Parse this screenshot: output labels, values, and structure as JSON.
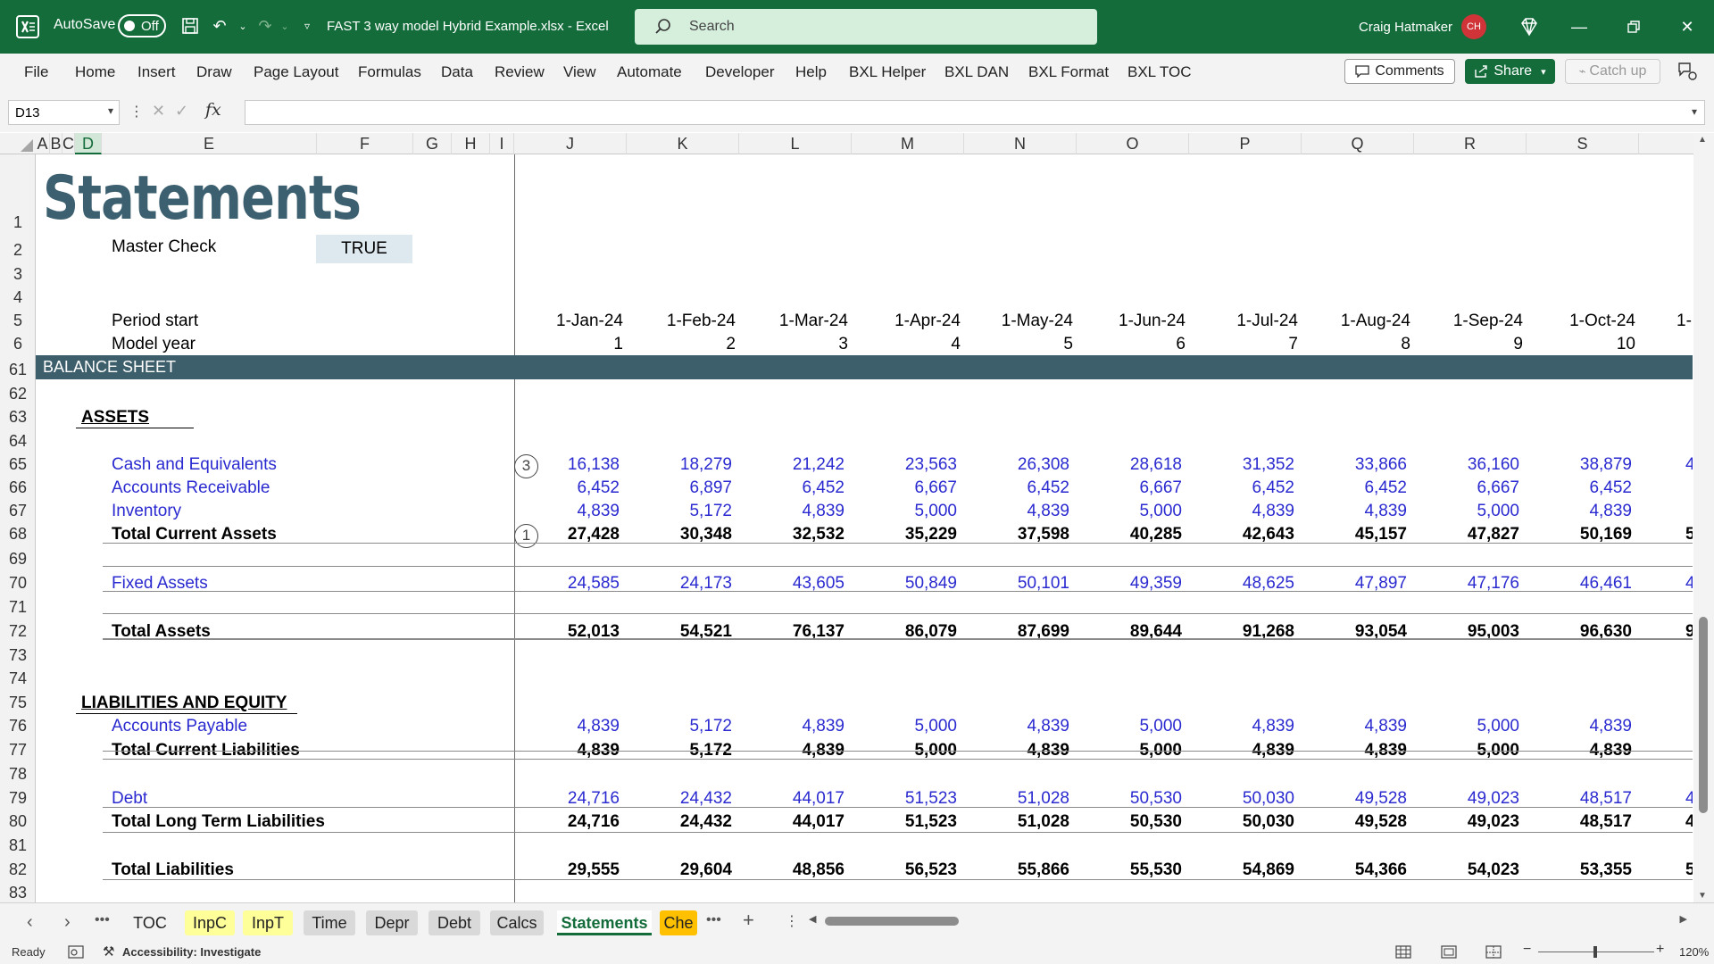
{
  "titlebar": {
    "autosave_label": "AutoSave",
    "autosave_state": "Off",
    "doc_title": "FAST 3 way model Hybrid Example.xlsx  -  Excel",
    "search_placeholder": "Search",
    "user_name": "Craig Hatmaker",
    "user_initials": "CH",
    "accent_color": "#136c3a"
  },
  "ribbon": {
    "tabs": [
      "File",
      "Home",
      "Insert",
      "Draw",
      "Page Layout",
      "Formulas",
      "Data",
      "Review",
      "View",
      "Automate",
      "Developer",
      "Help",
      "BXL Helper",
      "BXL DAN",
      "BXL Format",
      "BXL TOC"
    ],
    "comments_label": "Comments",
    "share_label": "Share",
    "catchup_label": "Catch up"
  },
  "formula_bar": {
    "name_box": "D13",
    "formula": ""
  },
  "columns": [
    "A",
    "B",
    "C",
    "D",
    "E",
    "F",
    "G",
    "H",
    "I",
    "J",
    "K",
    "L",
    "M",
    "N",
    "O",
    "P",
    "Q",
    "R",
    "S"
  ],
  "rows": [
    "1",
    "2",
    "3",
    "4",
    "5",
    "6",
    "61",
    "62",
    "63",
    "64",
    "65",
    "66",
    "67",
    "68",
    "69",
    "70",
    "71",
    "72",
    "73",
    "74",
    "75",
    "76",
    "77",
    "78",
    "79",
    "80",
    "81",
    "82",
    "83"
  ],
  "sheet": {
    "title": "Statements",
    "master_check_label": "Master Check",
    "master_check_value": "TRUE",
    "period_start_label": "Period start",
    "model_year_label": "Model year",
    "periods": [
      "1-Jan-24",
      "1-Feb-24",
      "1-Mar-24",
      "1-Apr-24",
      "1-May-24",
      "1-Jun-24",
      "1-Jul-24",
      "1-Aug-24",
      "1-Sep-24",
      "1-Oct-24"
    ],
    "period_partial": "1-",
    "model_years": [
      "1",
      "2",
      "3",
      "4",
      "5",
      "6",
      "7",
      "8",
      "9",
      "10"
    ],
    "section_title": "BALANCE SHEET",
    "assets_header": "ASSETS",
    "liabilities_header": "LIABILITIES AND EQUITY",
    "line_items": [
      {
        "label": "Cash and Equivalents",
        "values": [
          "16,138",
          "18,279",
          "21,242",
          "23,563",
          "26,308",
          "28,618",
          "31,352",
          "33,866",
          "36,160",
          "38,879"
        ],
        "partial": "4",
        "circle": "3",
        "style": "input"
      },
      {
        "label": "Accounts Receivable",
        "values": [
          "6,452",
          "6,897",
          "6,452",
          "6,667",
          "6,452",
          "6,667",
          "6,452",
          "6,452",
          "6,667",
          "6,452"
        ],
        "partial": "",
        "circle": "",
        "style": "input"
      },
      {
        "label": "Inventory",
        "values": [
          "4,839",
          "5,172",
          "4,839",
          "5,000",
          "4,839",
          "5,000",
          "4,839",
          "4,839",
          "5,000",
          "4,839"
        ],
        "partial": "",
        "circle": "",
        "style": "input"
      },
      {
        "label": "Total Current Assets",
        "values": [
          "27,428",
          "30,348",
          "32,532",
          "35,229",
          "37,598",
          "40,285",
          "42,643",
          "45,157",
          "47,827",
          "50,169"
        ],
        "partial": "5",
        "circle": "1",
        "style": "total"
      },
      {
        "label": "Fixed Assets",
        "values": [
          "24,585",
          "24,173",
          "43,605",
          "50,849",
          "50,101",
          "49,359",
          "48,625",
          "47,897",
          "47,176",
          "46,461"
        ],
        "partial": "4",
        "circle": "",
        "style": "input"
      },
      {
        "label": "Total Assets",
        "values": [
          "52,013",
          "54,521",
          "76,137",
          "86,079",
          "87,699",
          "89,644",
          "91,268",
          "93,054",
          "95,003",
          "96,630"
        ],
        "partial": "9",
        "circle": "",
        "style": "total"
      },
      {
        "label": "Accounts Payable",
        "values": [
          "4,839",
          "5,172",
          "4,839",
          "5,000",
          "4,839",
          "5,000",
          "4,839",
          "4,839",
          "5,000",
          "4,839"
        ],
        "partial": "",
        "circle": "",
        "style": "input"
      },
      {
        "label": "Total Current Liabilities",
        "values": [
          "4,839",
          "5,172",
          "4,839",
          "5,000",
          "4,839",
          "5,000",
          "4,839",
          "4,839",
          "5,000",
          "4,839"
        ],
        "partial": "",
        "circle": "",
        "style": "total"
      },
      {
        "label": "Debt",
        "values": [
          "24,716",
          "24,432",
          "44,017",
          "51,523",
          "51,028",
          "50,530",
          "50,030",
          "49,528",
          "49,023",
          "48,517"
        ],
        "partial": "4",
        "circle": "",
        "style": "input"
      },
      {
        "label": "Total Long Term Liabilities",
        "values": [
          "24,716",
          "24,432",
          "44,017",
          "51,523",
          "51,028",
          "50,530",
          "50,030",
          "49,528",
          "49,023",
          "48,517"
        ],
        "partial": "4",
        "circle": "",
        "style": "total"
      },
      {
        "label": "Total Liabilities",
        "values": [
          "29,555",
          "29,604",
          "48,856",
          "56,523",
          "55,866",
          "55,530",
          "54,869",
          "54,366",
          "54,023",
          "53,355"
        ],
        "partial": "5",
        "circle": "",
        "style": "total"
      }
    ]
  },
  "sheet_tabs": [
    {
      "label": "TOC",
      "color": "#f3f3f3"
    },
    {
      "label": "InpC",
      "color": "#ffff99"
    },
    {
      "label": "InpT",
      "color": "#ffff99"
    },
    {
      "label": "Time",
      "color": "#d9d9d9"
    },
    {
      "label": "Depr",
      "color": "#d9d9d9"
    },
    {
      "label": "Debt",
      "color": "#d9d9d9"
    },
    {
      "label": "Calcs",
      "color": "#d9d9d9"
    },
    {
      "label": "Statements",
      "color": "#ffffff"
    },
    {
      "label": "Che",
      "color": "#ffc000"
    }
  ],
  "status": {
    "ready": "Ready",
    "accessibility": "Accessibility: Investigate",
    "zoom": "120%"
  }
}
